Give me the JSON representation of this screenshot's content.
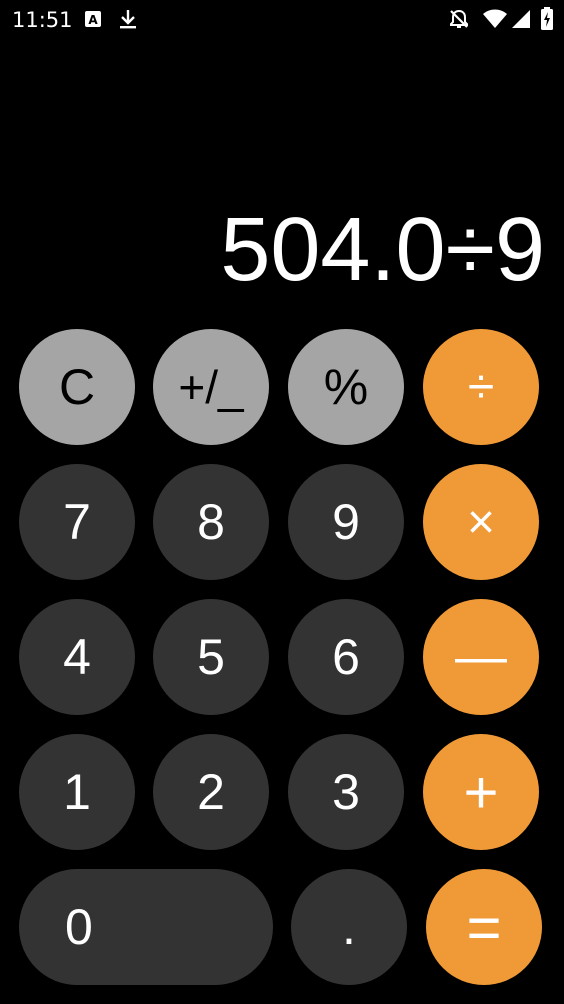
{
  "status_bar": {
    "time": "11:51",
    "icons": [
      "autofill-icon",
      "download-icon",
      "notifications-off-icon",
      "wifi-icon",
      "cell-signal-icon",
      "battery-charging-icon"
    ]
  },
  "display": {
    "expression": "504.0÷9"
  },
  "keys": {
    "clear": "C",
    "sign": "+/_",
    "percent": "%",
    "divide": "÷",
    "seven": "7",
    "eight": "8",
    "nine": "9",
    "multiply": "×",
    "four": "4",
    "five": "5",
    "six": "6",
    "minus": "—",
    "one": "1",
    "two": "2",
    "three": "3",
    "plus": "+",
    "zero": "0",
    "decimal": ".",
    "equals": "="
  },
  "colors": {
    "background": "#000000",
    "digit_key": "#333333",
    "function_key": "#a5a5a5",
    "operator_key": "#f09a37"
  }
}
